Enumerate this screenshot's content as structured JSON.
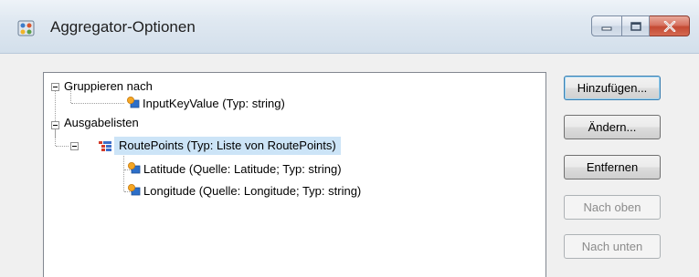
{
  "window": {
    "title": "Aggregator-Optionen"
  },
  "tree": {
    "nodes": {
      "group_by": "Gruppieren nach",
      "input_key_value": "InputKeyValue (Typ: string)",
      "output_lists": "Ausgabelisten",
      "route_points": "RoutePoints (Typ: Liste von RoutePoints)",
      "latitude": "Latitude (Quelle: Latitude; Typ: string)",
      "longitude": "Longitude (Quelle: Longitude; Typ: string)"
    },
    "selected": "route_points"
  },
  "buttons": {
    "add": "Hinzufügen...",
    "edit": "Ändern...",
    "remove": "Entfernen",
    "move_up": "Nach oben",
    "move_down": "Nach unten"
  },
  "colors": {
    "selection": "#cce4f7",
    "close_button": "#c44a33",
    "titlebar": "#dfe8f1"
  },
  "icons": {
    "app": "aggregator-app-icon",
    "field": "field-icon",
    "list": "list-icon",
    "minimize": "minimize-icon",
    "maximize": "maximize-icon",
    "close": "close-icon",
    "expand": "collapse-minus-icon"
  }
}
